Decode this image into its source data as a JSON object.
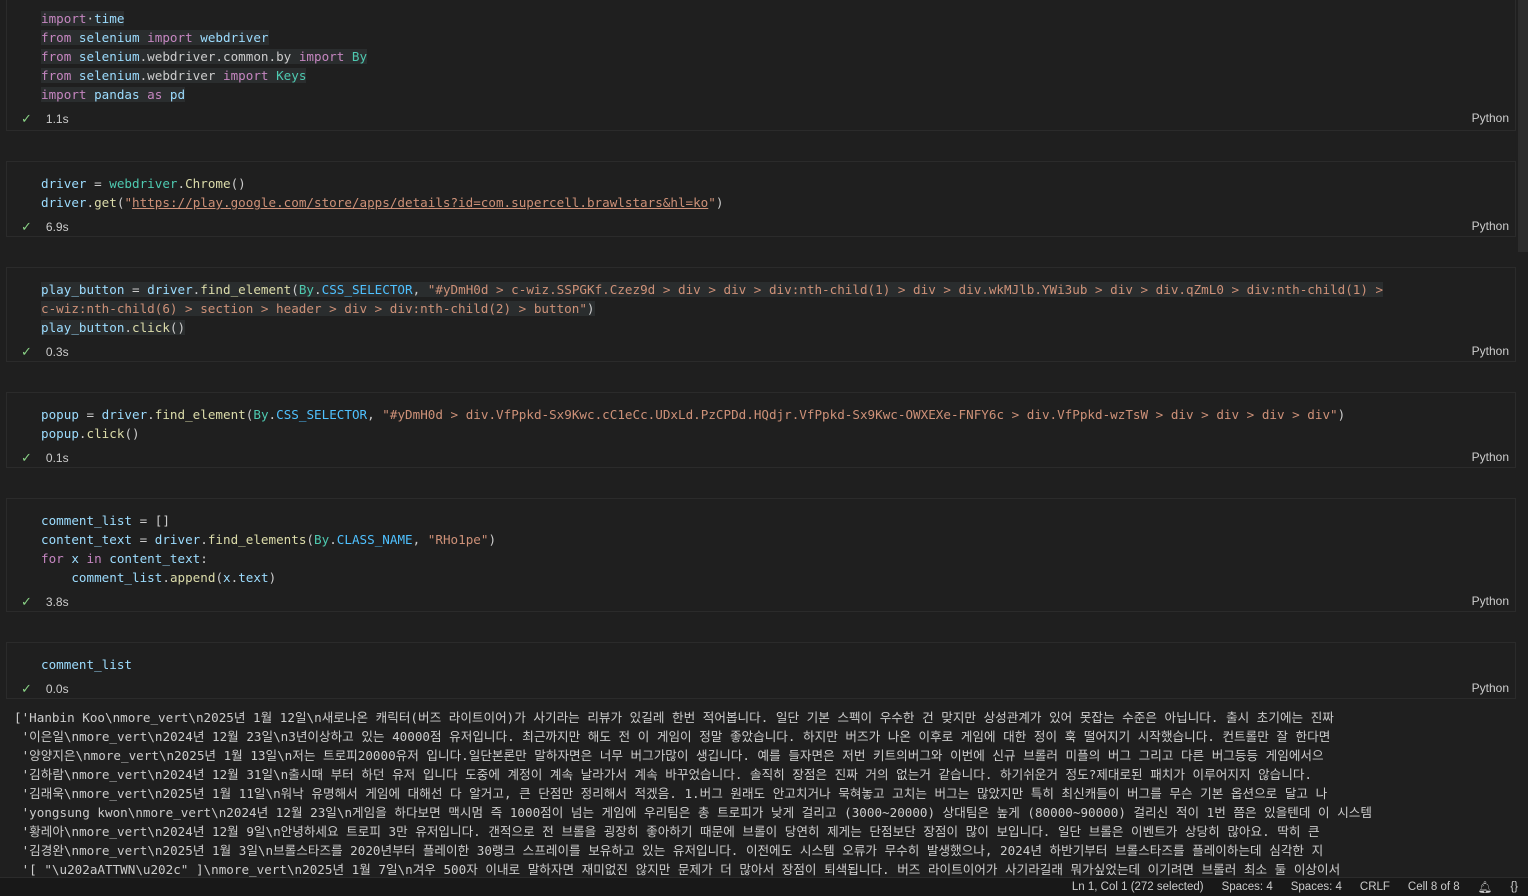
{
  "cells": [
    {
      "lines": [
        [
          [
            "kw",
            "import"
          ],
          [
            "",
            "·"
          ],
          [
            "var",
            "time"
          ]
        ],
        [
          [
            "kw",
            "from"
          ],
          [
            "",
            ""
          ],
          [
            "var",
            " selenium"
          ],
          [
            "kw",
            " import"
          ],
          [
            "var",
            " webdriver"
          ]
        ],
        [
          [
            "kw",
            "from"
          ],
          [
            "var",
            " selenium"
          ],
          [
            "",
            ".webdriver.common.by"
          ],
          [
            "kw",
            " import"
          ],
          [
            "cls",
            " By"
          ]
        ],
        [
          [
            "kw",
            "from"
          ],
          [
            "var",
            " selenium"
          ],
          [
            "",
            ".webdriver"
          ],
          [
            "kw",
            " import"
          ],
          [
            "cls",
            " Keys"
          ]
        ],
        [
          [
            "kw",
            "import"
          ],
          [
            "var",
            " pandas"
          ],
          [
            "kw",
            " as"
          ],
          [
            "var",
            " pd"
          ]
        ]
      ],
      "time": "1.1s",
      "lang": "Python"
    },
    {
      "lines": [
        [
          [
            "var",
            "driver"
          ],
          [
            "",
            " = "
          ],
          [
            "cls",
            "webdriver"
          ],
          [
            "",
            "."
          ],
          [
            "fn",
            "Chrome"
          ],
          [
            "",
            "()"
          ]
        ],
        [
          [
            "var",
            "driver"
          ],
          [
            "",
            "."
          ],
          [
            "fn",
            "get"
          ],
          [
            "",
            "("
          ],
          [
            "str",
            "\""
          ],
          [
            "url",
            "https://play.google.com/store/apps/details?id=com.supercell.brawlstars&hl=ko"
          ],
          [
            "str",
            "\""
          ],
          [
            "",
            ")"
          ]
        ]
      ],
      "time": "6.9s",
      "lang": "Python"
    },
    {
      "lines": [
        [
          [
            "var",
            "play_button"
          ],
          [
            "",
            " = "
          ],
          [
            "var",
            "driver"
          ],
          [
            "",
            "."
          ],
          [
            "fn",
            "find_element"
          ],
          [
            "",
            "("
          ],
          [
            "cls",
            "By"
          ],
          [
            "",
            "."
          ],
          [
            "const",
            "CSS_SELECTOR"
          ],
          [
            "",
            ", "
          ],
          [
            "str",
            "\"#yDmH0d > c-wiz.SSPGKf.Czez9d > div > div > div:nth-child(1) > div > div.wkMJlb.YWi3ub > div > div.qZmL0 > div:nth-child(1) >"
          ]
        ],
        [
          [
            "str",
            "c-wiz:nth-child(6) > section > header > div > div:nth-child(2) > button\""
          ],
          [
            "",
            ")"
          ]
        ],
        [
          [
            "var",
            "play_button"
          ],
          [
            "",
            "."
          ],
          [
            "fn",
            "click"
          ],
          [
            "",
            "()"
          ]
        ]
      ],
      "time": "0.3s",
      "lang": "Python"
    },
    {
      "lines": [
        [
          [
            "var",
            "popup"
          ],
          [
            "",
            " = "
          ],
          [
            "var",
            "driver"
          ],
          [
            "",
            "."
          ],
          [
            "fn",
            "find_element"
          ],
          [
            "",
            "("
          ],
          [
            "cls",
            "By"
          ],
          [
            "",
            "."
          ],
          [
            "const",
            "CSS_SELECTOR"
          ],
          [
            "",
            ", "
          ],
          [
            "str",
            "\"#yDmH0d > div.VfPpkd-Sx9Kwc.cC1eCc.UDxLd.PzCPDd.HQdjr.VfPpkd-Sx9Kwc-OWXEXe-FNFY6c > div.VfPpkd-wzTsW > div > div > div > div\""
          ],
          [
            "",
            ")"
          ]
        ],
        [
          [
            "var",
            "popup"
          ],
          [
            "",
            "."
          ],
          [
            "fn",
            "click"
          ],
          [
            "",
            "()"
          ]
        ]
      ],
      "time": "0.1s",
      "lang": "Python"
    },
    {
      "lines": [
        [
          [
            "var",
            "comment_list"
          ],
          [
            "",
            " = []"
          ]
        ],
        [
          [
            "var",
            "content_text"
          ],
          [
            "",
            " = "
          ],
          [
            "var",
            "driver"
          ],
          [
            "",
            "."
          ],
          [
            "fn",
            "find_elements"
          ],
          [
            "",
            "("
          ],
          [
            "cls",
            "By"
          ],
          [
            "",
            "."
          ],
          [
            "const",
            "CLASS_NAME"
          ],
          [
            "",
            ", "
          ],
          [
            "str",
            "\"RHo1pe\""
          ],
          [
            "",
            ")"
          ]
        ],
        [
          [
            "kw",
            "for"
          ],
          [
            "var",
            " x"
          ],
          [
            "kw",
            " in"
          ],
          [
            "var",
            " content_text"
          ],
          [
            "",
            ":"
          ]
        ],
        [
          [
            "",
            "    "
          ],
          [
            "var",
            "comment_list"
          ],
          [
            "",
            "."
          ],
          [
            "fn",
            "append"
          ],
          [
            "",
            "("
          ],
          [
            "var",
            "x"
          ],
          [
            "",
            "."
          ],
          [
            "var",
            "text"
          ],
          [
            "",
            ")"
          ]
        ]
      ],
      "time": "3.8s",
      "lang": "Python"
    },
    {
      "lines": [
        [
          [
            "var",
            "comment_list"
          ]
        ]
      ],
      "time": "0.0s",
      "lang": "Python"
    }
  ],
  "output_lines": [
    "['Hanbin Koo\\nmore_vert\\n2025년 1월 12일\\n새로나온 캐릭터(버즈 라이트이어)가 사기라는 리뷰가 있길레 한번 적어봅니다. 일단 기본 스펙이 우수한 건 맞지만 상성관계가 있어 못잡는 수준은 아닙니다. 출시 초기에는 진짜",
    " '이은일\\nmore_vert\\n2024년 12월 23일\\n3년이상하고 있는 40000점 유저입니다. 최근까지만 해도 전 이 게임이 정말 좋았습니다. 하지만 버즈가 나온 이후로 게임에 대한 정이 훅 떨어지기 시작했습니다. 컨트롤만 잘 한다면",
    " '양양지은\\nmore_vert\\n2025년 1월 13일\\n저는 트로피20000유저 입니다.일단본론만 말하자면은 너무 버그가많이 생깁니다. 예를 들자면은 저번 키트의버그와 이번에 신규 브롤러 미플의 버그 그리고 다른 버그등등 게임에서으",
    " '김하람\\nmore_vert\\n2024년 12월 31일\\n출시때 부터 하던 유저 입니다 도중에 계정이 계속 날라가서 계속 바꾸었습니다. 솔직히 장점은 진짜 거의 없는거 같습니다. 하기쉬운거 정도?제대로된 패치가 이루어지지 않습니다. ",
    " '김래욱\\nmore_vert\\n2025년 1월 11일\\n워낙 유명해서 게임에 대해선 다 알거고, 큰 단점만 정리해서 적겠음. 1.버그 원래도 안고치거나 묵혀놓고 고치는 버그는 많았지만 특히 최신캐들이 버그를 무슨 기본 옵션으로 달고 나",
    " 'yongsung kwon\\nmore_vert\\n2024년 12월 23일\\n게임을 하다보면 맥시멈 즉 1000점이 넘는 게임에 우리팀은 총 트로피가 낮게 걸리고 (3000~20000) 상대팀은 높게 (80000~90000) 걸리신 적이 1번 쯤은 있을텐데 이 시스템",
    " '황레아\\nmore_vert\\n2024년 12월 9일\\n안녕하세요 트로피 3만 유저입니다. 갠적으로 전 브롤을 굉장히 좋아하기 때문에 브롤이 당연히 제게는 단점보단 장점이 많이 보입니다. 일단 브롤은 이벤트가 상당히 많아요. 딱히 큰",
    " '김경완\\nmore_vert\\n2025년 1월 3일\\n브롤스타즈를 2020년부터 플레이한 30랭크 스프레이를 보유하고 있는 유저입니다. 이전에도 시스템 오류가 무수히 발생했으나, 2024년 하반기부터 브롤스타즈를 플레이하는데 심각한 지",
    " '[ \"\\u202aATTWN\\u202c\" ]\\nmore_vert\\n2025년 1월 7일\\n겨우 500자 이내로 말하자면 재미없진 않지만 문제가 더 많아서 장점이 퇴색됩니다. 버즈 라이트이어가 사기라길래 뭐가싶었는데 이기려면 브롤러 최소 둘 이상이서"
  ],
  "statusbar": {
    "position": "Ln 1, Col 1 (272 selected)",
    "spaces1": "Spaces: 4",
    "spaces2": "Spaces: 4",
    "eol": "CRLF",
    "cell": "Cell 8 of 8"
  },
  "colors": {
    "check": "#89d185",
    "keyword": "#c586c0",
    "function": "#dcdcaa",
    "class": "#4ec9b0",
    "variable": "#9cdcfe",
    "string": "#ce9178"
  }
}
